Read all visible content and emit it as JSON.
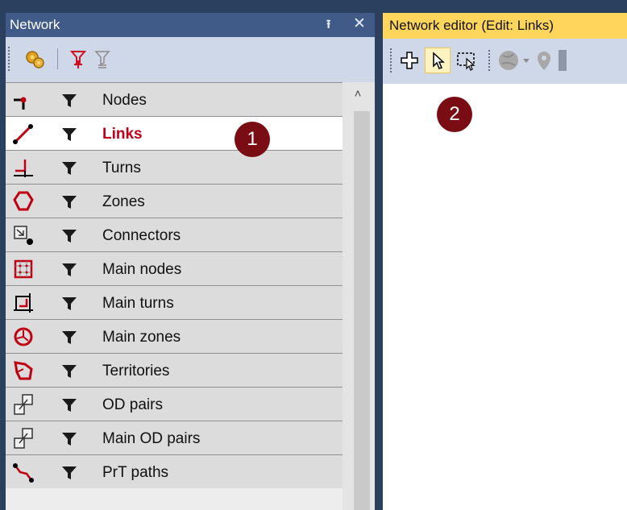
{
  "network_panel": {
    "title": "Network",
    "pin_icon": "pin-icon",
    "close_icon": "close-icon",
    "toolbar": {
      "icons": [
        "gear-icon",
        "filter-red-icon",
        "filter-outline-icon"
      ]
    },
    "items": [
      {
        "label": "Nodes",
        "icon": "node-icon",
        "selected": false
      },
      {
        "label": "Links",
        "icon": "link-icon",
        "selected": true
      },
      {
        "label": "Turns",
        "icon": "turn-icon",
        "selected": false
      },
      {
        "label": "Zones",
        "icon": "zone-icon",
        "selected": false
      },
      {
        "label": "Connectors",
        "icon": "connector-icon",
        "selected": false
      },
      {
        "label": "Main nodes",
        "icon": "main-node-icon",
        "selected": false
      },
      {
        "label": "Main turns",
        "icon": "main-turn-icon",
        "selected": false
      },
      {
        "label": "Main zones",
        "icon": "main-zone-icon",
        "selected": false
      },
      {
        "label": "Territories",
        "icon": "territory-icon",
        "selected": false
      },
      {
        "label": "OD pairs",
        "icon": "od-pair-icon",
        "selected": false
      },
      {
        "label": "Main OD pairs",
        "icon": "main-od-pair-icon",
        "selected": false
      },
      {
        "label": "PrT paths",
        "icon": "prt-path-icon",
        "selected": false
      }
    ]
  },
  "editor_panel": {
    "title": "Network editor (Edit: Links)",
    "toolbar": {
      "icons": [
        "insert-cross-icon",
        "select-pointer-icon",
        "rect-select-icon",
        "globe-icon",
        "dropdown-arrow-icon",
        "map-pin-icon"
      ]
    }
  },
  "callouts": {
    "one": "1",
    "two": "2"
  },
  "colors": {
    "title_blue": "#405b87",
    "active_title_yellow": "#ffd55c",
    "selected_label_red": "#c0001a",
    "callout_dark_red": "#7a0d14"
  }
}
